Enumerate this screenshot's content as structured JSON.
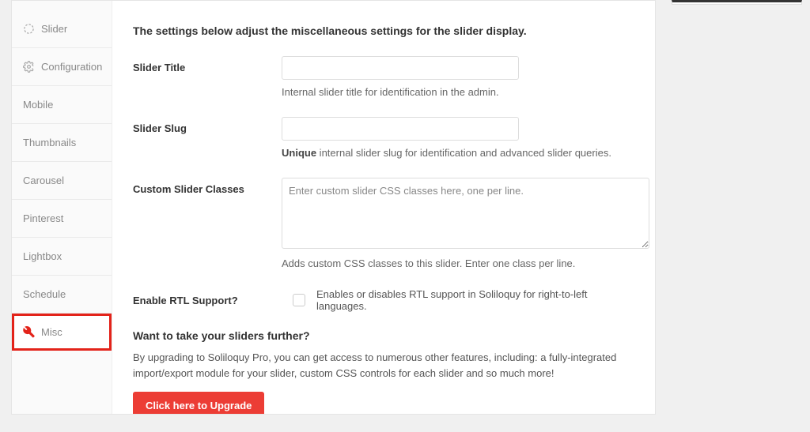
{
  "sidebar": {
    "items": [
      {
        "label": "Slider"
      },
      {
        "label": "Configuration"
      },
      {
        "label": "Mobile"
      },
      {
        "label": "Thumbnails"
      },
      {
        "label": "Carousel"
      },
      {
        "label": "Pinterest"
      },
      {
        "label": "Lightbox"
      },
      {
        "label": "Schedule"
      },
      {
        "label": "Misc"
      }
    ]
  },
  "content": {
    "heading": "The settings below adjust the miscellaneous settings for the slider display.",
    "slider_title": {
      "label": "Slider Title",
      "value": "",
      "help": "Internal slider title for identification in the admin."
    },
    "slider_slug": {
      "label": "Slider Slug",
      "value": "",
      "help_bold": "Unique",
      "help_rest": " internal slider slug for identification and advanced slider queries."
    },
    "custom_classes": {
      "label": "Custom Slider Classes",
      "placeholder": "Enter custom slider CSS classes here, one per line.",
      "value": "",
      "help": "Adds custom CSS classes to this slider. Enter one class per line."
    },
    "rtl": {
      "label": "Enable RTL Support?",
      "checked": false,
      "desc": "Enables or disables RTL support in Soliloquy for right-to-left languages."
    },
    "upsell": {
      "heading": "Want to take your sliders further?",
      "text": "By upgrading to Soliloquy Pro, you can get access to numerous other features, including: a fully-integrated import/export module for your slider, custom CSS controls for each slider and so much more!",
      "button": "Click here to Upgrade"
    }
  }
}
